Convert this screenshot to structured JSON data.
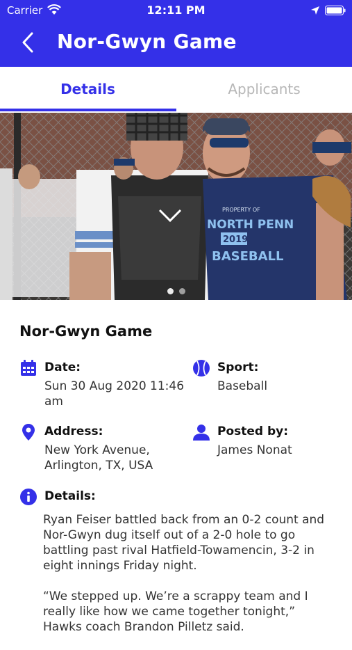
{
  "status_bar": {
    "carrier": "Carrier",
    "time": "12:11 PM"
  },
  "nav": {
    "title": "Nor-Gwyn Game"
  },
  "tabs": [
    {
      "label": "Details",
      "active": true
    },
    {
      "label": "Applicants",
      "active": false
    }
  ],
  "photo": {
    "page_count": 2,
    "current_page": 1,
    "jersey_lines": [
      "PROPERTY OF",
      "NORTH PENN",
      "2019",
      "BASEBALL"
    ]
  },
  "game": {
    "title": "Nor-Gwyn Game",
    "date_label": "Date:",
    "date_value_line1": "Sun 30 Aug 2020 11:46",
    "date_value_line2": "am",
    "sport_label": "Sport:",
    "sport_value": "Baseball",
    "address_label": "Address:",
    "address_line1": "New York Avenue,",
    "address_line2": "Arlington, TX, USA",
    "posted_by_label": "Posted by:",
    "posted_by_value": "James Nonat",
    "details_label": "Details:",
    "details_paragraphs": [
      "Ryan Feiser battled back from an 0-2 count and Nor-Gwyn dug itself out of a 2-0 hole to go battling past rival Hatfield-Towamencin, 3-2 in eight innings Friday night.",
      "“We stepped up. We’re a scrappy team and I really like how we came together tonight,” Hawks coach Brandon Pilletz said."
    ]
  },
  "colors": {
    "brand": "#3430e8",
    "inactive_tab": "#b7b7b7"
  },
  "icons": [
    "back-chevron-icon",
    "wifi-icon",
    "location-arrow-icon",
    "battery-icon",
    "calendar-icon",
    "baseball-icon",
    "map-pin-icon",
    "user-icon",
    "info-icon"
  ]
}
